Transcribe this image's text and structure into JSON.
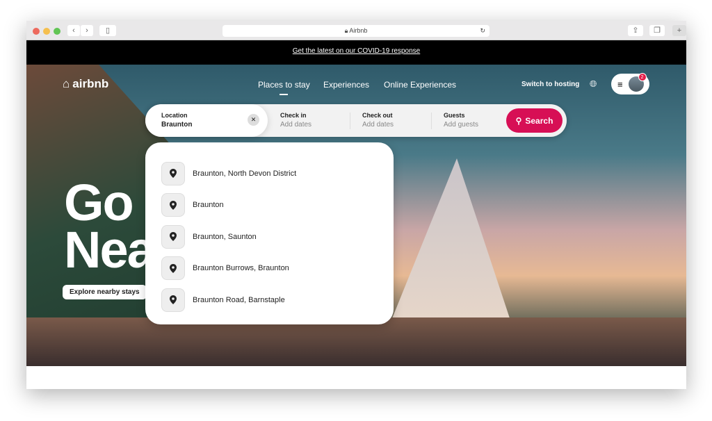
{
  "browser": {
    "title": "Airbnb",
    "colors": {
      "close": "#ed6a5e",
      "min": "#f5bf4f",
      "max": "#61c554"
    }
  },
  "banner": {
    "text": "Get the latest on our COVID-19 response"
  },
  "header": {
    "logo": "airbnb",
    "nav": [
      {
        "label": "Places to stay",
        "active": true
      },
      {
        "label": "Experiences"
      },
      {
        "label": "Online Experiences"
      }
    ],
    "host_link": "Switch to hosting",
    "notification_count": "2"
  },
  "search": {
    "location_label": "Location",
    "location_value": "Braunton",
    "checkin_label": "Check in",
    "checkin_placeholder": "Add dates",
    "checkout_label": "Check out",
    "checkout_placeholder": "Add dates",
    "guests_label": "Guests",
    "guests_placeholder": "Add guests",
    "button": "Search",
    "accent": "#d70f55"
  },
  "suggestions": [
    "Braunton, North Devon District",
    "Braunton",
    "Braunton, Saunton",
    "Braunton Burrows, Braunton",
    "Braunton Road, Barnstaple"
  ],
  "hero": {
    "headline_1": "Go",
    "headline_2": "Near",
    "cta": "Explore nearby stays"
  }
}
